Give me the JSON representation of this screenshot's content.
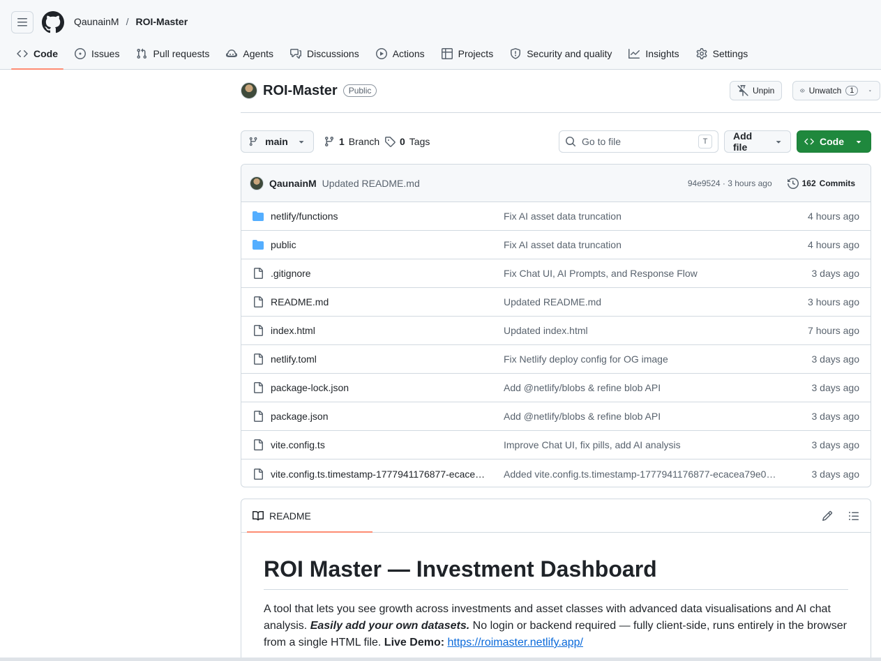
{
  "header": {
    "owner": "QaunainM",
    "separator": "/",
    "repo": "ROI-Master"
  },
  "nav": {
    "tabs": [
      {
        "label": "Code",
        "icon": "code-icon",
        "active": true
      },
      {
        "label": "Issues",
        "icon": "issue-opened-icon"
      },
      {
        "label": "Pull requests",
        "icon": "git-pull-request-icon"
      },
      {
        "label": "Agents",
        "icon": "agent-icon"
      },
      {
        "label": "Discussions",
        "icon": "comment-discussion-icon"
      },
      {
        "label": "Actions",
        "icon": "play-icon"
      },
      {
        "label": "Projects",
        "icon": "table-icon"
      },
      {
        "label": "Security and quality",
        "icon": "shield-icon"
      },
      {
        "label": "Insights",
        "icon": "graph-icon"
      },
      {
        "label": "Settings",
        "icon": "gear-icon"
      }
    ]
  },
  "repo": {
    "name": "ROI-Master",
    "visibility": "Public",
    "unpin_label": "Unpin",
    "unwatch_label": "Unwatch",
    "watch_count": "1"
  },
  "toolbar": {
    "branch": "main",
    "branch_count": "1",
    "branch_label": "Branch",
    "tag_count": "0",
    "tag_label": "Tags",
    "goto_placeholder": "Go to file",
    "goto_shortcut": "T",
    "add_file_label": "Add file",
    "code_label": "Code"
  },
  "latest_commit": {
    "author": "QaunainM",
    "message": "Updated README.md",
    "sha_time": "94e9524 · 3 hours ago",
    "commits_count": "162",
    "commits_label": "Commits"
  },
  "files": [
    {
      "type": "folder",
      "name": "netlify/functions",
      "message": "Fix AI asset data truncation",
      "date": "4 hours ago"
    },
    {
      "type": "folder",
      "name": "public",
      "message": "Fix AI asset data truncation",
      "date": "4 hours ago"
    },
    {
      "type": "file",
      "name": ".gitignore",
      "message": "Fix Chat UI, AI Prompts, and Response Flow",
      "date": "3 days ago"
    },
    {
      "type": "file",
      "name": "README.md",
      "message": "Updated README.md",
      "date": "3 hours ago"
    },
    {
      "type": "file",
      "name": "index.html",
      "message": "Updated index.html",
      "date": "7 hours ago"
    },
    {
      "type": "file",
      "name": "netlify.toml",
      "message": "Fix Netlify deploy config for OG image",
      "date": "3 days ago"
    },
    {
      "type": "file",
      "name": "package-lock.json",
      "message": "Add @netlify/blobs & refine blob API",
      "date": "3 days ago"
    },
    {
      "type": "file",
      "name": "package.json",
      "message": "Add @netlify/blobs & refine blob API",
      "date": "3 days ago"
    },
    {
      "type": "file",
      "name": "vite.config.ts",
      "message": "Improve Chat UI, fix pills, add AI analysis",
      "date": "3 days ago"
    },
    {
      "type": "file",
      "name": "vite.config.ts.timestamp-1777941176877-ecace…",
      "message": "Added vite.config.ts.timestamp-1777941176877-ecacea79e0…",
      "date": "3 days ago"
    }
  ],
  "readme": {
    "tab_label": "README",
    "title": "ROI Master — Investment Dashboard",
    "para_1": "A tool that lets you see growth across investments and asset classes with advanced data visualisations and AI chat analysis. ",
    "para_em": "Easily add your own datasets.",
    "para_2": " No login or backend required — fully client-side, runs entirely in the browser from a single HTML file. ",
    "demo_label": "Live Demo:",
    "demo_link": "https://roimaster.netlify.app/"
  }
}
